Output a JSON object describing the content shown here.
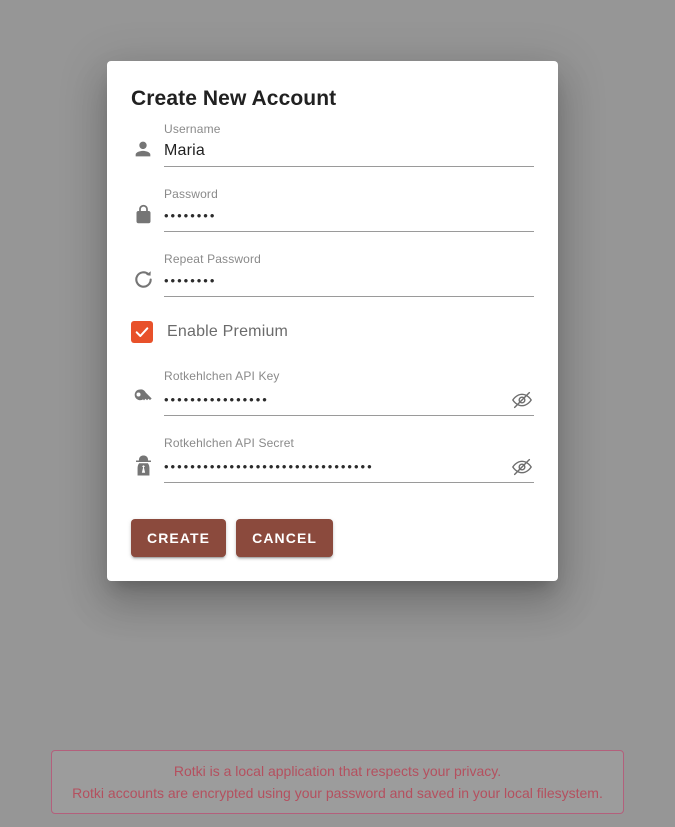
{
  "theme": {
    "background": "#969696",
    "dialog_background": "#ffffff",
    "accent_checkbox": "#e8512a",
    "button_color": "#8b4a3d",
    "banner_border": "#b3607c",
    "banner_text": "#b4505f",
    "icon_color": "#757575",
    "label_color": "#8a8a8a"
  },
  "dialog": {
    "title": "Create New Account",
    "fields": [
      {
        "name": "username",
        "icon": "account-icon",
        "label": "Username",
        "value": "Maria",
        "masked": false,
        "has_toggle": false
      },
      {
        "name": "password",
        "icon": "lock-icon",
        "label": "Password",
        "value": "••••••••",
        "masked": true,
        "has_toggle": false
      },
      {
        "name": "repeat-password",
        "icon": "restore-icon",
        "label": "Repeat Password",
        "value": "••••••••",
        "masked": true,
        "has_toggle": false
      }
    ],
    "premium_checkbox": {
      "label": "Enable Premium",
      "checked": true,
      "icon": "check-icon"
    },
    "premium_fields": [
      {
        "name": "rotkehlchen-api-key",
        "icon": "key-icon",
        "label": "Rotkehlchen API Key",
        "value": "••••••••••••••••",
        "masked": true,
        "has_toggle": true,
        "toggle_icon": "eye-off-icon"
      },
      {
        "name": "rotkehlchen-api-secret",
        "icon": "spy-icon",
        "label": "Rotkehlchen API Secret",
        "value": "••••••••••••••••••••••••••••••••",
        "masked": true,
        "has_toggle": true,
        "toggle_icon": "eye-off-icon"
      }
    ],
    "actions": {
      "create_label": "CREATE",
      "cancel_label": "CANCEL"
    }
  },
  "privacy_banner": {
    "line1": "Rotki is a local application that respects your privacy.",
    "line2": "Rotki accounts are encrypted using your password and saved in your local filesystem."
  }
}
